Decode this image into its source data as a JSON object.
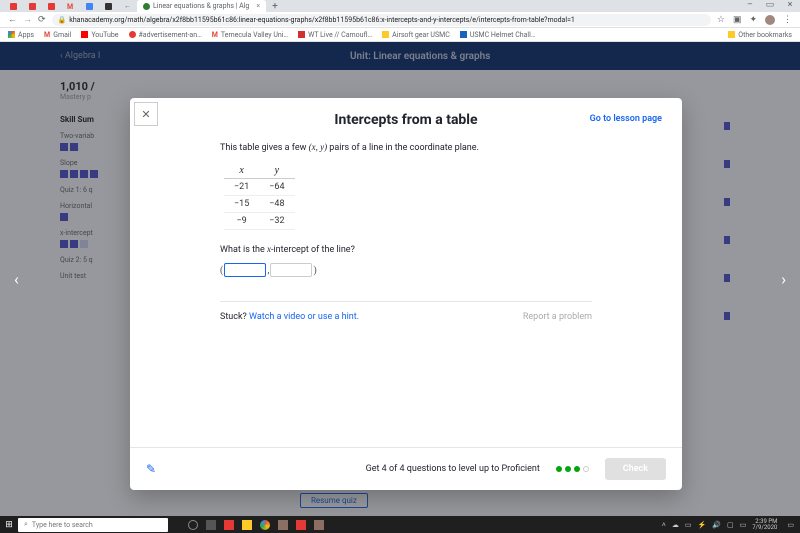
{
  "window": {
    "minimize": "–",
    "maximize": "▭",
    "close": "×"
  },
  "tabs": {
    "t1": "",
    "t2": "",
    "t3": "",
    "gmail": "M",
    "settings": "",
    "note": "",
    "back": "",
    "active_title": "Linear equations & graphs | Alg",
    "plus": "+"
  },
  "address": {
    "lock": "🔒",
    "url": "khanacademy.org/math/algebra/x2f8bb11595b61c86:linear-equations-graphs/x2f8bb11595b61c86:x-intercepts-and-y-intercepts/e/intercepts-from-table?modal=1",
    "star": "☆"
  },
  "bookmarks": {
    "apps": "Apps",
    "gmail": "Gmail",
    "youtube": "YouTube",
    "adv": "#advertisement-an…",
    "tvu": "Temecula Valley Uni…",
    "wt": "WT Live // Camoufl…",
    "airsoft": "Airsoft gear USMC",
    "helmet": "USMC Helmet Chall…",
    "other": "Other bookmarks"
  },
  "ka": {
    "breadcrumb": "‹ Algebra I",
    "unit": "Unit: Linear equations & graphs",
    "mastery": "1,010 /",
    "mastery_sub": "Mastery p",
    "skill_summary": "Skill Sum",
    "items": [
      "Two-variab",
      "Slope",
      "Quiz 1: 6 q",
      "Horizontal",
      "x-intercept",
      "Quiz 2: 5 q",
      "Unit test"
    ],
    "resume": "Resume quiz"
  },
  "modal": {
    "title": "Intercepts from a table",
    "lesson_link": "Go to lesson page",
    "prompt_a": "This table gives a few ",
    "prompt_pair": "(x, y)",
    "prompt_b": " pairs of a line in the coordinate plane.",
    "table": {
      "hx": "x",
      "hy": "y",
      "rows": [
        {
          "x": "−21",
          "y": "−64"
        },
        {
          "x": "−15",
          "y": "−48"
        },
        {
          "x": "−9",
          "y": "−32"
        }
      ]
    },
    "question_a": "What is the ",
    "question_var": "x",
    "question_b": "-intercept of the line?",
    "paren_open": "(",
    "comma": ",",
    "paren_close": ")",
    "stuck_label": "Stuck? ",
    "stuck_link": "Watch a video or use a hint.",
    "report": "Report a problem",
    "progress": "Get 4 of 4 questions to level up to Proficient",
    "check": "Check"
  },
  "taskbar": {
    "search_placeholder": "Type here to search",
    "time": "2:39 PM",
    "date": "7/9/2020"
  }
}
